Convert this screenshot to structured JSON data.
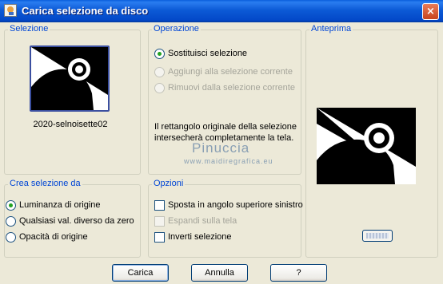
{
  "window": {
    "title": "Carica selezione da disco",
    "close_label": "×"
  },
  "selezione": {
    "group_label": "Selezione",
    "selected_file": "2020-selnoisette02"
  },
  "operazione": {
    "group_label": "Operazione",
    "options": [
      {
        "label": "Sostituisci selezione",
        "checked": true,
        "enabled": true
      },
      {
        "label": "Aggiungi alla selezione corrente",
        "checked": false,
        "enabled": false
      },
      {
        "label": "Rimuovi dalla selezione corrente",
        "checked": false,
        "enabled": false
      }
    ],
    "info_line1": "Il rettangolo originale della selezione",
    "info_line2": "intersecherà completamente la tela."
  },
  "anteprima": {
    "group_label": "Anteprima"
  },
  "crea": {
    "group_label": "Crea selezione da",
    "options": [
      {
        "label": "Luminanza di origine",
        "checked": true
      },
      {
        "label": "Qualsiasi val. diverso da zero",
        "checked": false
      },
      {
        "label": "Opacità di origine",
        "checked": false
      }
    ]
  },
  "opzioni": {
    "group_label": "Opzioni",
    "options": [
      {
        "label": "Sposta in angolo superiore sinistro",
        "checked": false,
        "enabled": true
      },
      {
        "label": "Espandi sulla tela",
        "checked": false,
        "enabled": false
      },
      {
        "label": "Inverti selezione",
        "checked": false,
        "enabled": true
      }
    ]
  },
  "watermark": {
    "name": "Pinuccia",
    "url": "www.maidiregrafica.eu"
  },
  "buttons": {
    "ok": "Carica",
    "cancel": "Annulla",
    "help": "?"
  },
  "colors": {
    "titlebar": "#0348c8",
    "group_label": "#0046d5",
    "face": "#ece9d8",
    "radio_dot": "#21a121"
  }
}
